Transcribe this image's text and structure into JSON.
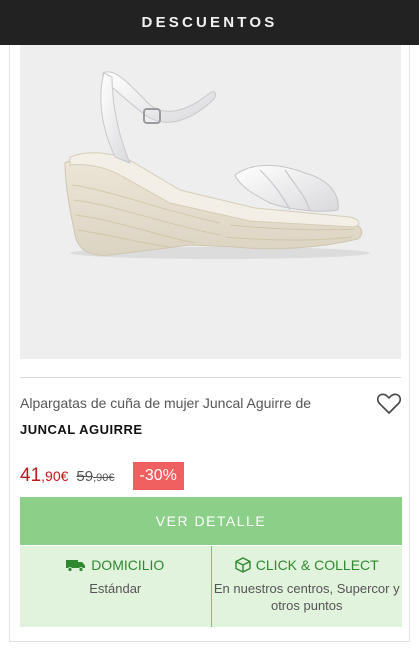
{
  "header": {
    "title": "DESCUENTOS"
  },
  "product": {
    "name": "Alpargatas de cuña de mujer Juncal Aguirre de",
    "brand": "JUNCAL AGUIRRE",
    "price": {
      "integer": "41",
      "decimal": ",90€"
    },
    "old_price": {
      "integer": "59",
      "decimal": ",90€"
    },
    "discount": "-30%",
    "image_icon": "white-wedge-espadrille-sandal"
  },
  "actions": {
    "detail_label": "VER DETALLE",
    "favorite_icon": "heart-outline-icon"
  },
  "delivery": {
    "home": {
      "label": "DOMICILIO",
      "detail": "Estándar",
      "icon": "truck-icon"
    },
    "collect": {
      "label": "CLICK & COLLECT",
      "detail": "En nuestros centros, Supercor y otros puntos",
      "icon": "box-icon"
    }
  },
  "colors": {
    "price": "#c0171c",
    "badge": "#f06060",
    "button": "#8ccf88",
    "delivery_bg": "#e1f2dd",
    "delivery_text": "#2f8a2f",
    "header_bg": "#222222"
  }
}
